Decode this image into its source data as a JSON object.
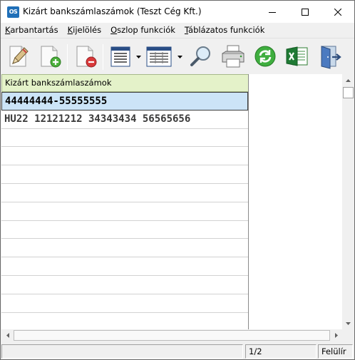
{
  "window": {
    "app_icon_text": "OS",
    "title": "Kizárt bankszámlaszámok (Teszt Cég Kft.)"
  },
  "menu": {
    "items": [
      "Karbantartás",
      "Kijelölés",
      "Oszlop funkciók",
      "Táblázatos funkciók"
    ]
  },
  "toolbar": {
    "buttons": [
      {
        "icon": "edit-pencil-icon"
      },
      {
        "icon": "new-document-icon"
      },
      {
        "icon": "delete-document-icon"
      },
      {
        "icon": "list-view-icon"
      },
      {
        "icon": "table-view-icon"
      },
      {
        "icon": "search-magnifier-icon"
      },
      {
        "icon": "printer-icon"
      },
      {
        "icon": "refresh-icon"
      },
      {
        "icon": "excel-export-icon"
      },
      {
        "icon": "exit-door-icon"
      }
    ]
  },
  "grid": {
    "column_header": "Kizárt bankszámlaszámok",
    "rows": [
      "44444444-55555555",
      "HU22 12121212 34343434 56565656"
    ]
  },
  "statusbar": {
    "page": "1/2",
    "mode": "Felülír"
  },
  "colors": {
    "header_bg": "#e4f2c9",
    "selected_row_bg": "#cce4f7",
    "app_icon_bg": "#1f6fb8"
  }
}
